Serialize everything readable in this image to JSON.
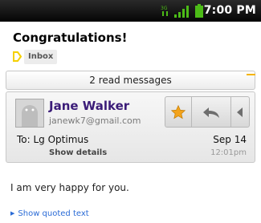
{
  "status_bar": {
    "time": "7:00 PM",
    "icons": [
      "network-activity-icon",
      "signal-strength-icon",
      "battery-icon"
    ],
    "background": "#000000"
  },
  "message": {
    "subject": "Congratulations!",
    "label": "Inbox",
    "label_color": "#f5d000",
    "read_bar": "2 read messages",
    "sender": {
      "name": "Jane Walker",
      "email": "janewk7@gmail.com",
      "name_color": "#3b1c78"
    },
    "to_line": "To: Lg Optimus",
    "show_details": "Show details",
    "date": "Sep 14",
    "time": "12:01pm",
    "actions": [
      "star-icon",
      "reply-icon",
      "more-left-chevron-icon"
    ],
    "body": "I am very happy for you.",
    "quoted_link": "Show quoted text"
  }
}
